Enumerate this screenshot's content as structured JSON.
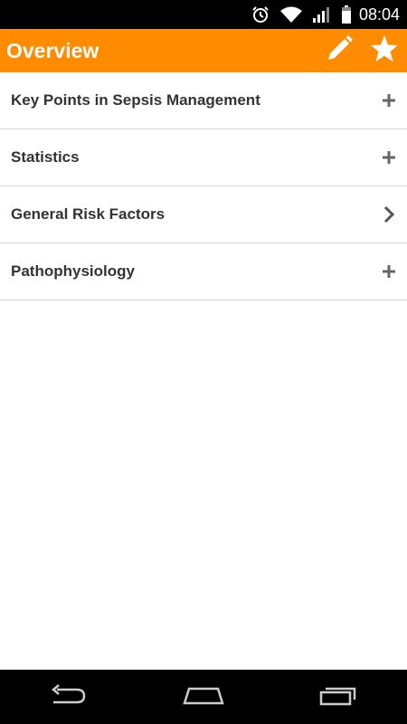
{
  "status_bar": {
    "time": "08:04",
    "icons": [
      "alarm-icon",
      "wifi-icon",
      "signal-icon",
      "battery-icon"
    ]
  },
  "action_bar": {
    "title": "Overview",
    "color": "#ff8c00",
    "actions": [
      "edit-icon",
      "star-icon"
    ]
  },
  "list": {
    "items": [
      {
        "label": "Key Points in Sepsis Management",
        "indicator": "plus-icon"
      },
      {
        "label": "Statistics",
        "indicator": "plus-icon"
      },
      {
        "label": "General Risk Factors",
        "indicator": "chevron-right-icon"
      },
      {
        "label": "Pathophysiology",
        "indicator": "plus-icon"
      }
    ]
  },
  "nav_bar": {
    "buttons": [
      "back-icon",
      "home-icon",
      "recent-apps-icon"
    ]
  }
}
